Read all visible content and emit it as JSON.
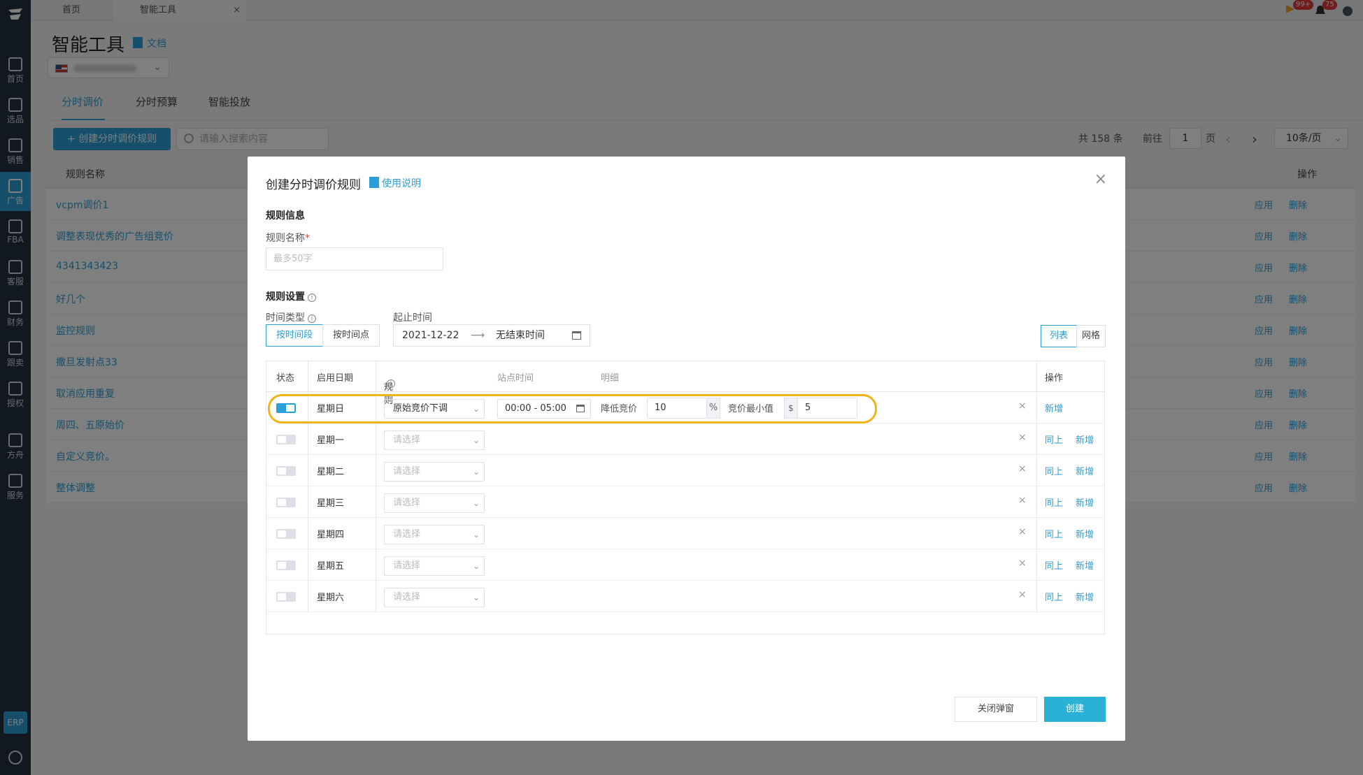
{
  "top_tabs": [
    {
      "label": "首页"
    },
    {
      "label": "智能工具",
      "close": "×"
    }
  ],
  "notifications": {
    "badge1": "99+",
    "badge2": "75"
  },
  "sidebar": {
    "items": [
      {
        "label": "首页",
        "icon": "home-icon"
      },
      {
        "label": "选品",
        "icon": "search-icon"
      },
      {
        "label": "销售",
        "icon": "chart-icon"
      },
      {
        "label": "广告",
        "icon": "ad-icon",
        "active": true
      },
      {
        "label": "FBA",
        "icon": "fba-icon"
      },
      {
        "label": "客服",
        "icon": "service-icon"
      },
      {
        "label": "财务",
        "icon": "dollar-icon"
      },
      {
        "label": "跟卖",
        "icon": "pie-icon"
      },
      {
        "label": "授权",
        "icon": "shield-icon"
      },
      {
        "label": "方舟",
        "icon": "ark-icon"
      },
      {
        "label": "服务",
        "icon": "building-icon"
      }
    ],
    "erp": "ERP"
  },
  "page": {
    "title": "智能工具",
    "doc_link": "文档",
    "tabs": [
      "分时调价",
      "分时预算",
      "智能投放"
    ],
    "create_button": "+ 创建分时调价规则",
    "search_placeholder": "请输入搜索内容",
    "pagination": {
      "total": "共 158 条",
      "goto": "前往",
      "page": "1",
      "page_unit": "页",
      "prev": "‹",
      "next": "›",
      "size": "10条/页"
    },
    "list_header": {
      "name": "规则名称",
      "ops": "操作"
    },
    "rules": [
      {
        "name": "vcpm调价1"
      },
      {
        "name": "调整表现优秀的广告组竞价"
      },
      {
        "name": "4341343423"
      },
      {
        "name": "好几个"
      },
      {
        "name": "监控规则"
      },
      {
        "name": "撒旦发射点33"
      },
      {
        "name": "取消应用重复"
      },
      {
        "name": "周四、五原始价"
      },
      {
        "name": "自定义竞价。"
      },
      {
        "name": "整体调整"
      }
    ],
    "apply_label": "应用",
    "delete_label": "删除"
  },
  "modal": {
    "title": "创建分时调价规则",
    "help_link": "使用说明",
    "close": "×",
    "rule_info_title": "规则信息",
    "rule_name_label": "规则名称",
    "required_mark": "*",
    "rule_name_placeholder": "最多50字",
    "rule_settings_title": "规则设置",
    "time_type_label": "时间类型",
    "time_type_options": [
      "按时间段",
      "按时间点"
    ],
    "range_label": "起止时间",
    "start_date": "2021-12-22",
    "arrow": "⟶",
    "end_date": "无结束时间",
    "view_options": [
      "列表",
      "网格"
    ],
    "table_headers": {
      "status": "状态",
      "date": "启用日期",
      "rule": "规则",
      "site_time": "站点时间",
      "detail": "明细",
      "ops": "操作"
    },
    "rows": [
      {
        "day": "星期日",
        "enabled": true,
        "rule": "原始竞价下调",
        "time": "00:00 - 05:00",
        "lower_label": "降低竞价",
        "lower_value": "10",
        "pct": "%",
        "min_label": "竞价最小值",
        "currency": "$",
        "min_value": "5"
      },
      {
        "day": "星期一",
        "enabled": false,
        "rule": "请选择"
      },
      {
        "day": "星期二",
        "enabled": false,
        "rule": "请选择"
      },
      {
        "day": "星期三",
        "enabled": false,
        "rule": "请选择"
      },
      {
        "day": "星期四",
        "enabled": false,
        "rule": "请选择"
      },
      {
        "day": "星期五",
        "enabled": false,
        "rule": "请选择"
      },
      {
        "day": "星期六",
        "enabled": false,
        "rule": "请选择"
      }
    ],
    "remove": "×",
    "same_as_above": "同上",
    "add": "新增",
    "close_button": "关闭弹窗",
    "create_button": "创建"
  },
  "colors": {
    "accent": "#2a9fd8",
    "highlight": "#f0b318",
    "sidebar": "#233040"
  }
}
